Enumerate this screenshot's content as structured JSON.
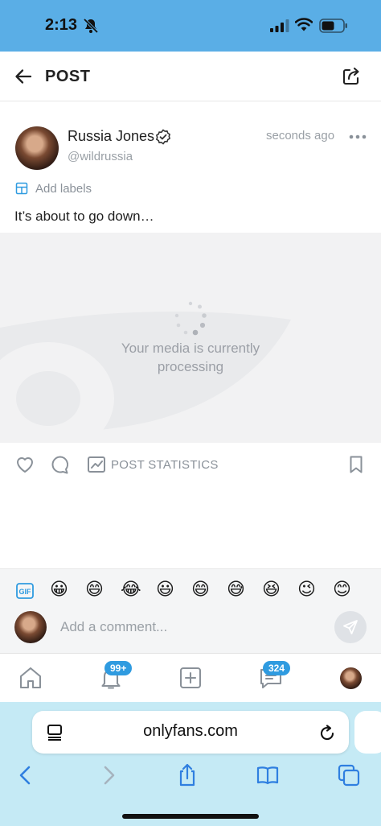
{
  "status_bar": {
    "time": "2:13"
  },
  "header": {
    "title": "POST"
  },
  "post": {
    "author_name": "Russia Jones",
    "author_handle": "@wildrussia",
    "timestamp": "seconds ago",
    "labels_link": "Add labels",
    "text": "It’s about to go down…",
    "media_status_line1": "Your media is currently",
    "media_status_line2": "processing",
    "stats_label": "POST STATISTICS"
  },
  "emoji_bar": {
    "gif_label": "GIF",
    "emojis": [
      "😀",
      "😄",
      "😂",
      "😃",
      "😄",
      "😅",
      "😆",
      "😉",
      "😊"
    ]
  },
  "comment": {
    "placeholder": "Add a comment..."
  },
  "bottom_nav": {
    "notifications_badge": "99+",
    "messages_badge": "324"
  },
  "browser": {
    "url": "onlyfans.com"
  },
  "colors": {
    "status_bar": "#5aaee6",
    "accent": "#2f9be0",
    "safari_chrome": "#c5eaf5",
    "icon_gray": "#8a9199"
  },
  "icons": [
    "bell-off-icon",
    "signal-icon",
    "wifi-icon",
    "battery-icon",
    "back-arrow-icon",
    "share-icon",
    "verified-icon",
    "more-icon",
    "label-icon",
    "spinner-icon",
    "like-icon",
    "comment-icon",
    "stats-icon",
    "bookmark-icon",
    "gif-icon",
    "send-icon",
    "home-icon",
    "notifications-icon",
    "add-post-icon",
    "messages-icon",
    "page-menu-icon",
    "reload-icon",
    "browser-back-icon",
    "browser-forward-icon",
    "browser-share-icon",
    "bookmarks-icon",
    "tabs-icon"
  ]
}
